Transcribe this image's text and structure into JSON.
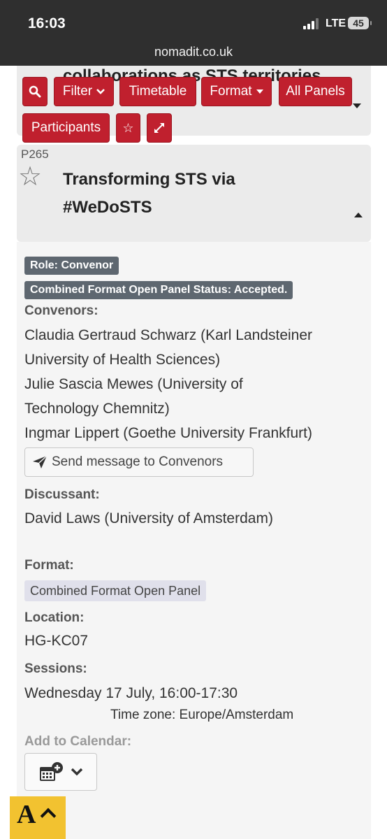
{
  "status_bar": {
    "time": "16:03",
    "network": "LTE",
    "battery": "45"
  },
  "browser": {
    "url": "nomadit.co.uk"
  },
  "toolbar": {
    "filter_label": "Filter",
    "timetable_label": "Timetable",
    "format_label": "Format",
    "all_panels_label": "All Panels",
    "participants_label": "Participants"
  },
  "previous_panel": {
    "title": "collaborations as STS territories"
  },
  "panel": {
    "code": "P265",
    "title": "Transforming STS via #WeDoSTS",
    "role_badge": "Role: Convenor",
    "status_badge": "Combined Format Open Panel Status: Accepted.",
    "convenors_label": "Convenors:",
    "convenors": [
      "Claudia Gertraud Schwarz (Karl Landsteiner University of Health Sciences)",
      "Julie Sascia Mewes (University of Technology Chemnitz)",
      "Ingmar Lippert (Goethe University Frankfurt)"
    ],
    "send_message_label": "Send message to Convenors",
    "discussant_label": "Discussant:",
    "discussant": "David Laws (University of Amsterdam)",
    "format_label": "Format:",
    "format_value": "Combined Format Open Panel",
    "location_label": "Location:",
    "location_value": "HG-KC07",
    "sessions_label": "Sessions:",
    "session_time": "Wednesday 17 July, 16:00-17:30",
    "timezone": "Time zone: Europe/Amsterdam",
    "add_calendar_label": "Add to Calendar:"
  },
  "accessibility": {
    "glyph": "A"
  },
  "icons": [
    "search-icon",
    "star-icon",
    "expand-icon",
    "paper-plane-icon",
    "calendar-plus-icon",
    "chevron-down-icon"
  ],
  "colors": {
    "accent": "#c0202e",
    "badge": "#5e6770",
    "chrome": "#2f2f2f",
    "a11y": "#f2c230"
  }
}
